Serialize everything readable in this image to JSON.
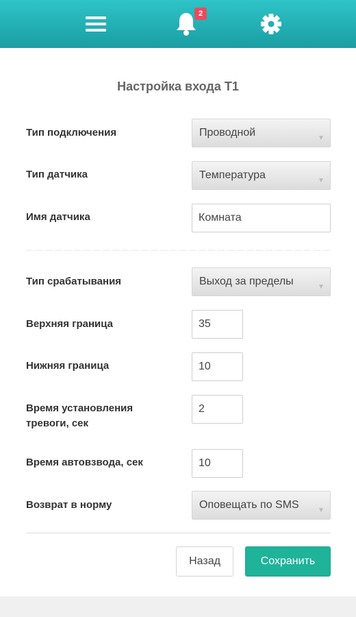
{
  "header": {
    "notification_count": "2",
    "icons": [
      "menu-icon",
      "bell-icon",
      "gear-icon"
    ],
    "color_top": "#2ec4c8",
    "color_bottom": "#1a9ea3"
  },
  "form": {
    "title": "Настройка входа Т1",
    "connection_type": {
      "label": "Тип подключения",
      "value": "Проводной"
    },
    "sensor_type": {
      "label": "Тип датчика",
      "value": "Температура"
    },
    "sensor_name": {
      "label": "Имя датчика",
      "value": "Комната"
    },
    "trigger_type": {
      "label": "Тип срабатывания",
      "value": "Выход за пределы"
    },
    "upper_limit": {
      "label": "Верхняя граница",
      "value": "35"
    },
    "lower_limit": {
      "label": "Нижняя граница",
      "value": "10"
    },
    "alarm_delay": {
      "label_line1": "Время установления",
      "label_line2": "тревоги, сек",
      "value": "2"
    },
    "auto_arm": {
      "label": "Время автовзвода, сек",
      "value": "10"
    },
    "return_normal": {
      "label": "Возврат в норму",
      "value": "Оповещать по SMS"
    }
  },
  "buttons": {
    "back": "Назад",
    "save": "Сохранить",
    "save_color": "#1fb39a"
  }
}
